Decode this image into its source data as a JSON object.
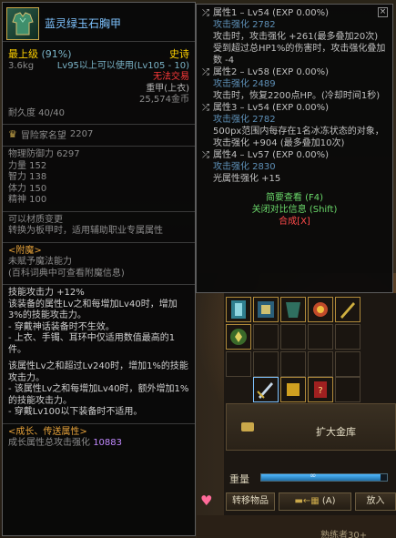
{
  "item": {
    "name": "蓝灵绿玉石胸甲",
    "grade": "最上级",
    "grade_pct": "(91%)",
    "rarity": "史诗",
    "weight": "3.6kg",
    "level_req": "Lv95以上可以使用(Lv105 - 10)",
    "trade": "无法交易",
    "armor_type": "重甲(上衣)",
    "price": "25,574金币",
    "durability_label": "耐久度 40/40",
    "fame_label": "冒险家名望",
    "fame_value": "2207",
    "stats": [
      "物理防御力 6297",
      "力量 152",
      "智力 138",
      "体力 150",
      "精神 100"
    ],
    "material_lines": [
      "可以材质变更",
      "转换为板甲时，适用辅助职业专属属性"
    ],
    "enchant_title": "<附魔>",
    "enchant_lines": [
      "未赋予魔法能力",
      "(百科词典中可查看附魔信息)"
    ],
    "skill_lines": [
      "技能攻击力 +12%",
      "该装备的属性Lv之和每增加Lv40时，增加3%的技能攻击力。",
      "- 穿戴神话装备时不生效。",
      "- 上衣、手镯、耳环中仅适用数值最高的1件。",
      "",
      "该属性Lv之和超过Lv240时，增加1%的技能攻击力。",
      "- 该属性Lv之和每增加Lv40时，额外增加1%的技能攻击力。",
      "- 穿戴Lv100以下装备时不适用。"
    ],
    "growth_title": "<成长、传送属性>",
    "growth_label": "成长属性总攻击强化",
    "growth_value": "10883"
  },
  "attributes": [
    {
      "title": "属性1 – Lv54 (EXP 0.00%)",
      "stat": "攻击强化 2782",
      "desc": [
        "攻击时，攻击强化 +261(最多叠加20次)",
        "受到超过总HP1%的伤害时，攻击强化叠加数 -4"
      ]
    },
    {
      "title": "属性2 – Lv58 (EXP 0.00%)",
      "stat": "攻击强化 2489",
      "desc": [
        "攻击时，恢复2200点HP。(冷却时间1秒)"
      ]
    },
    {
      "title": "属性3 – Lv54 (EXP 0.00%)",
      "stat": "攻击强化 2782",
      "desc": [
        "500px范围内每存在1名冰冻状态的对象，攻击强化 +904 (最多叠加10次)"
      ]
    },
    {
      "title": "属性4 – Lv57 (EXP 0.00%)",
      "stat": "攻击强化 2830",
      "desc": [
        "光属性强化 +15"
      ]
    }
  ],
  "tooltip_links": {
    "brief": "简要查看 (F4)",
    "compare": "关闭对比信息 (Shift)",
    "synthesize": "合成[X]"
  },
  "inventory": {
    "bank_label": "扩大金库",
    "weight_label": "重量",
    "weight_fill": 0.95,
    "weight_value": "∞",
    "transfer_button": "转移物品",
    "sort_button": "(A)",
    "put_button": "放入",
    "bottom_text": "熟练者30+"
  },
  "colors": {
    "epic": "#ffd100",
    "item_name": "#7ec3ff",
    "warn": "#ff3a3a",
    "highlight": "#6d7cff"
  }
}
